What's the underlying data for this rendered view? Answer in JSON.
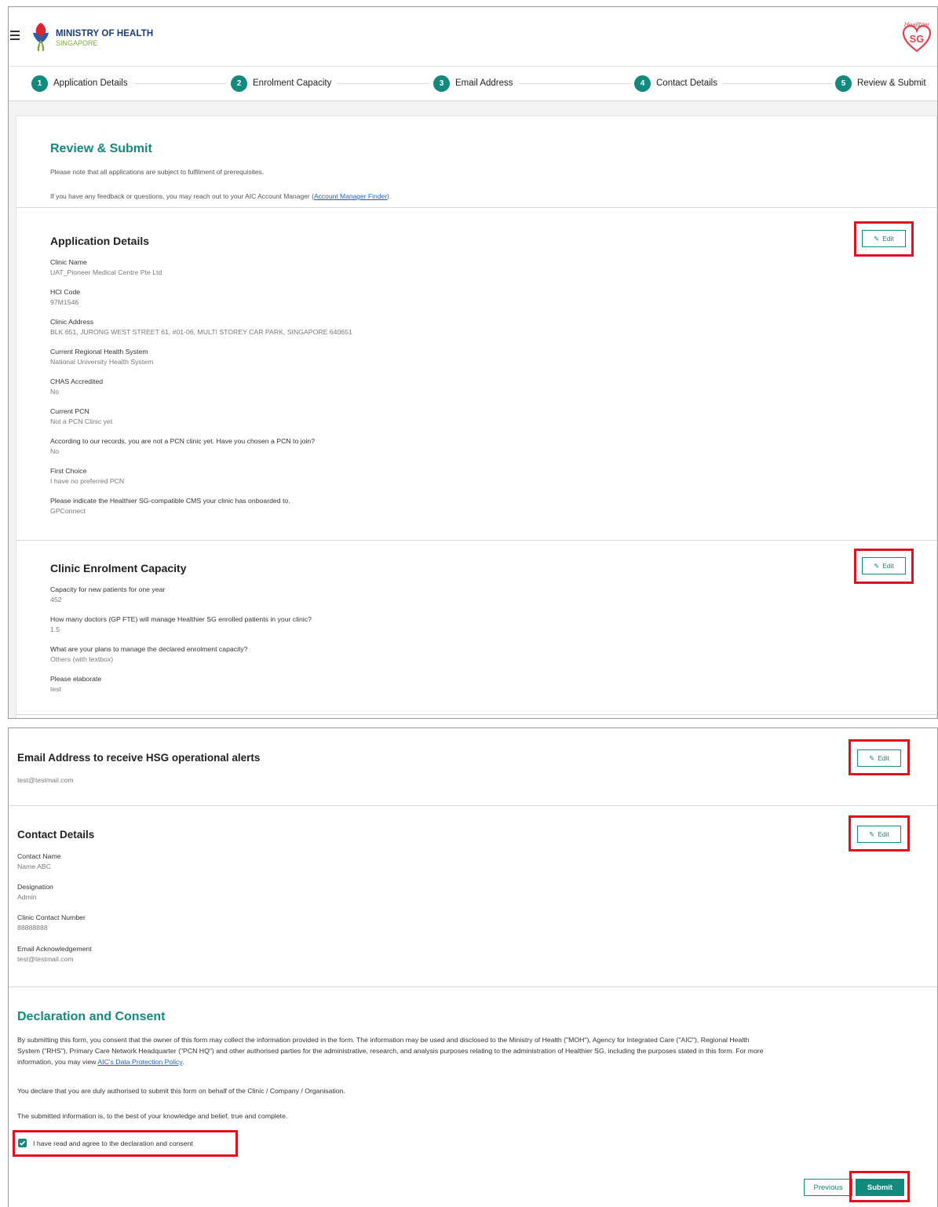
{
  "header": {
    "org_line1": "MINISTRY OF HEALTH",
    "org_line2": "SINGAPORE",
    "hsg_logo_top": "Healthier",
    "hsg_logo_sg": "SG"
  },
  "stepper": [
    {
      "num": "1",
      "label": "Application Details"
    },
    {
      "num": "2",
      "label": "Enrolment Capacity"
    },
    {
      "num": "3",
      "label": "Email Address"
    },
    {
      "num": "4",
      "label": "Contact Details"
    },
    {
      "num": "5",
      "label": "Review & Submit"
    }
  ],
  "review": {
    "title": "Review & Submit",
    "note1": "Please note that all applications are subject to fulfilment of prerequisites.",
    "note2_prefix": "If you have any feedback or questions, you may reach out to your AIC Account Manager (",
    "note2_link": "Account Manager Finder",
    "note2_suffix": ")."
  },
  "edit_label": "Edit",
  "application_details": {
    "title": "Application Details",
    "fields": [
      {
        "label": "Clinic Name",
        "value": "UAT_Pioneer Medical Centre Pte Ltd"
      },
      {
        "label": "HCI Code",
        "value": "97M1546"
      },
      {
        "label": "Clinic Address",
        "value": "BLK 651, JURONG WEST STREET 61, #01-06, MULTI STOREY CAR PARK, SINGAPORE 640651"
      },
      {
        "label": "Current Regional Health System",
        "value": "National University Health System"
      },
      {
        "label": "CHAS Accredited",
        "value": "No"
      },
      {
        "label": "Current PCN",
        "value": "Not a PCN Clinic yet"
      },
      {
        "label": "According to our records, you are not a PCN clinic yet. Have you chosen a PCN to join?",
        "value": "No"
      },
      {
        "label": "First Choice",
        "value": "I have no preferred PCN"
      },
      {
        "label": "Please indicate the Healthier SG-compatible CMS your clinic has onboarded to.",
        "value": "GPConnect"
      }
    ]
  },
  "enrolment_capacity": {
    "title": "Clinic Enrolment Capacity",
    "fields": [
      {
        "label": "Capacity for new patients for one year",
        "value": "452"
      },
      {
        "label": "How many doctors (GP FTE) will manage Healthier SG enrolled patients in your clinic?",
        "value": "1.5"
      },
      {
        "label": "What are your plans to manage the declared enrolment capacity?",
        "value": "Others (with textbox)"
      },
      {
        "label": "Please elaborate",
        "value": "test"
      }
    ]
  },
  "email_section": {
    "title": "Email Address to receive HSG operational alerts",
    "value": "test@testmail.com"
  },
  "contact_details": {
    "title": "Contact Details",
    "fields": [
      {
        "label": "Contact Name",
        "value": "Name ABC"
      },
      {
        "label": "Designation",
        "value": "Admin"
      },
      {
        "label": "Clinic Contact Number",
        "value": "88888888"
      },
      {
        "label": "Email Acknowledgement",
        "value": "test@testmail.com"
      }
    ]
  },
  "declaration": {
    "title": "Declaration and Consent",
    "para1_line1": "By submitting this form, you consent that the owner of this form may collect the information provided in the form. The information may be used and disclosed to the Ministry of Health (\"MOH\"), Agency for Integrated Care (\"AIC\"), Regional Health",
    "para1_line2": "System (\"RHS\"), Primary Care Network Headquarter (\"PCN HQ\") and other authorised parties for the administrative, research, and analysis purposes relating to the administration of Healthier SG, including the purposes stated in this form. For more",
    "para1_line3_prefix": "information, you may view ",
    "para1_link": "AIC's Data Protection Policy",
    "para1_line3_suffix": ".",
    "para2": "You declare that you are duly authorised to submit this form on behalf of the Clinic / Company / Organisation.",
    "para3": "The submitted information is, to the best of your knowledge and belief, true and complete.",
    "checkbox_label": "I have read and agree to the declaration and consent",
    "checkbox_checked": true
  },
  "buttons": {
    "previous": "Previous",
    "submit": "Submit"
  },
  "colors": {
    "accent": "#128a7d",
    "highlight": "#e0101c",
    "link": "#1a5fd1"
  }
}
